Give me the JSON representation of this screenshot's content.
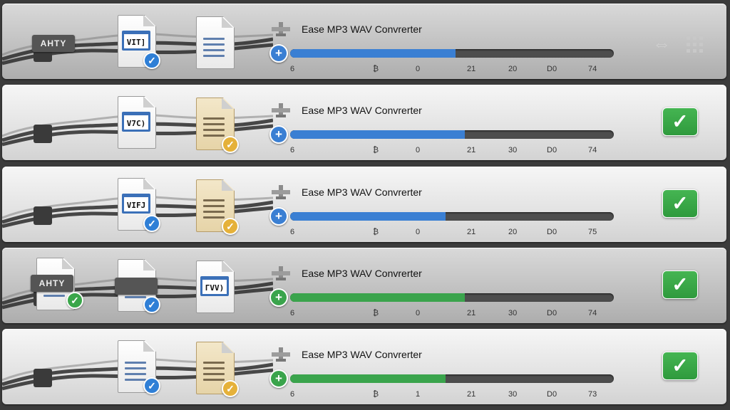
{
  "rows": [
    {
      "title": "Ease MP3 WAV Convrerter",
      "source": {
        "kind": "tag",
        "label": "ΑΗΤΥ"
      },
      "middle": {
        "kind": "screen",
        "label": "VΙΤ]",
        "badge": "blue"
      },
      "output": {
        "kind": "doc-blue"
      },
      "progress": 0.51,
      "fill_color": "#3a7fd3",
      "ticks": [
        "6",
        "₿",
        "0",
        "21",
        "20",
        "D0",
        "74"
      ],
      "right": "toolbar"
    },
    {
      "title": "Ease MP3 WAV Convrerter",
      "source": {
        "kind": "none"
      },
      "middle": {
        "kind": "screen",
        "label": "V7C)",
        "badge": "none"
      },
      "output": {
        "kind": "paper",
        "badge": "gold"
      },
      "progress": 0.54,
      "fill_color": "#3a7fd3",
      "ticks": [
        "6",
        "₿",
        "0",
        "21",
        "30",
        "D0",
        "74"
      ],
      "right": "check"
    },
    {
      "title": "Ease MP3 WAV Convrerter",
      "source": {
        "kind": "none"
      },
      "middle": {
        "kind": "screen",
        "label": "VΙFJ",
        "badge": "blue"
      },
      "output": {
        "kind": "paper",
        "badge": "gold"
      },
      "progress": 0.48,
      "fill_color": "#3a7fd3",
      "ticks": [
        "6",
        "₿",
        "0",
        "21",
        "20",
        "D0",
        "75"
      ],
      "right": "check"
    },
    {
      "title": "Ease MP3 WAV Convrerter",
      "source": {
        "kind": "tag-doc",
        "label": "ΑΗΤΥ",
        "badge": "green"
      },
      "middle": {
        "kind": "lines",
        "badge": "blue"
      },
      "output": {
        "kind": "screen",
        "label": "ΓVV)"
      },
      "progress": 0.54,
      "fill_color": "#3aa44c",
      "ticks": [
        "6",
        "₿",
        "0",
        "21",
        "30",
        "D0",
        "74"
      ],
      "right": "check"
    },
    {
      "title": "Ease MP3 WAV Convrerter",
      "source": {
        "kind": "none"
      },
      "middle": {
        "kind": "doc-blue",
        "badge": "blue"
      },
      "output": {
        "kind": "paper",
        "badge": "gold"
      },
      "progress": 0.48,
      "fill_color": "#3aa44c",
      "ticks": [
        "6",
        "₿",
        "1",
        "21",
        "30",
        "D0",
        "73"
      ],
      "right": "check"
    }
  ],
  "icons": {
    "pin": "usb-plug-icon",
    "plus": "plus-icon",
    "check": "checkmark-icon",
    "swap": "swap-arrows-icon",
    "grid": "grid-icon"
  },
  "colors": {
    "blue_badge": "#2f7fd6",
    "gold_badge": "#e5b13a",
    "green": "#3aa64a"
  }
}
